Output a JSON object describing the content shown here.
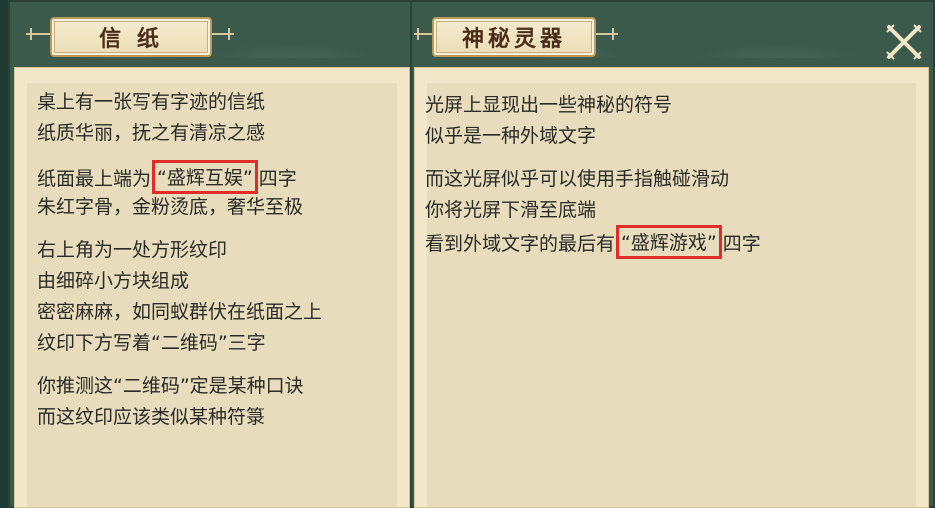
{
  "letter_panel": {
    "title": "信 纸",
    "paragraphs": [
      [
        "桌上有一张写有字迹的信纸",
        "纸质华丽，抚之有清凉之感"
      ],
      [
        "纸面最上端为",
        "“盛辉互娱”",
        "四字",
        "朱红字骨，金粉烫底，奢华至极"
      ],
      [
        "右上角为一处方形纹印",
        "由细碎小方块组成",
        "密密麻麻，如同蚁群伏在纸面之上",
        "纹印下方写着“二维码”三字"
      ],
      [
        "你推测这“二维码”定是某种口诀",
        "而这纹印应该类似某种符箓"
      ]
    ]
  },
  "artifact_panel": {
    "title": "神秘灵器",
    "paragraphs": [
      [
        "光屏上显现出一些神秘的符号",
        "似乎是一种外域文字"
      ],
      [
        "而这光屏似乎可以使用手指触碰滑动",
        "你将光屏下滑至底端",
        "看到外域文字的最后有",
        "“盛辉游戏”",
        "四字"
      ]
    ],
    "close_icon": "close-x-icon"
  },
  "colors": {
    "frame": "#3c5a4c",
    "paper": "#f2e8c9",
    "highlight_border": "#e22b2b",
    "text": "#2b2a26"
  }
}
